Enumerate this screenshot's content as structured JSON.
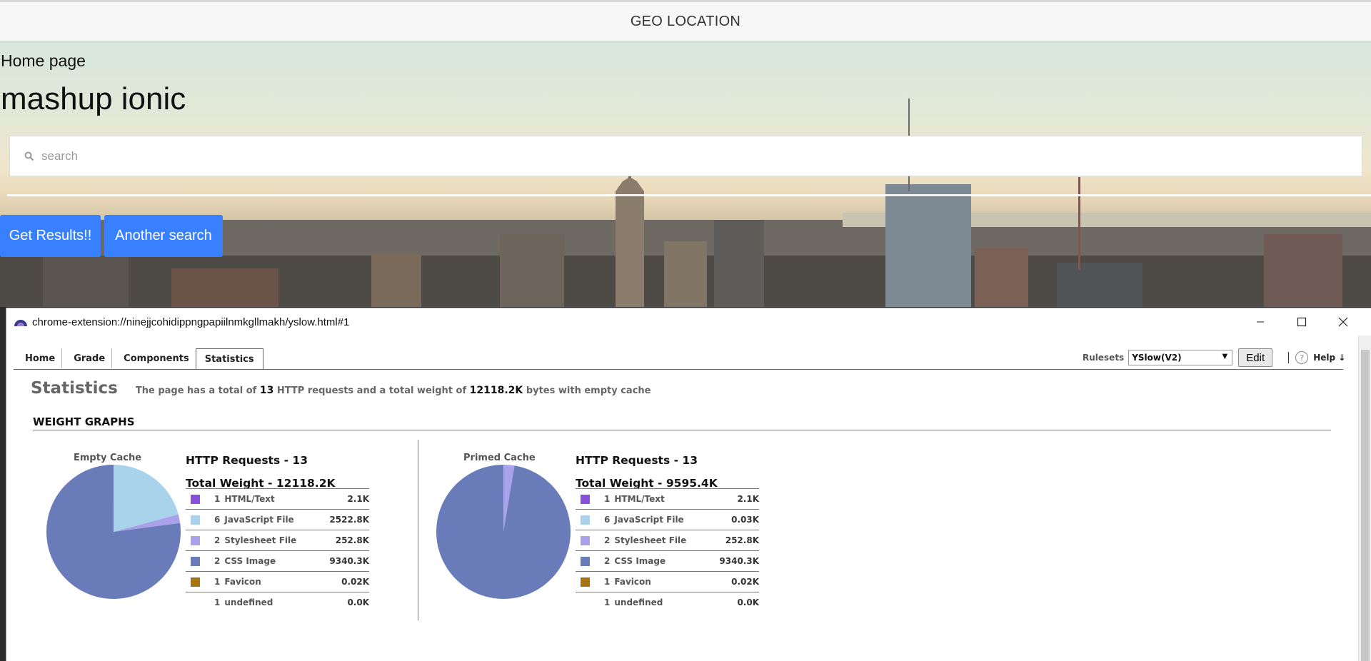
{
  "app": {
    "header_title": "GEO LOCATION",
    "home_label": "Home page",
    "title": "mashup ionic",
    "search": {
      "placeholder": "search",
      "value": ""
    },
    "buttons": {
      "get_results": "Get Results!!",
      "another_search": "Another search"
    },
    "accent_color": "#3880ff"
  },
  "window": {
    "url": "chrome-extension://ninejjcohidippngpapiilnmkgllmakh/yslow.html#1",
    "controls": {
      "minimize": "minimize-icon",
      "maximize": "maximize-icon",
      "close": "close-icon"
    }
  },
  "yslow": {
    "tabs": [
      {
        "label": "Home",
        "active": false
      },
      {
        "label": "Grade",
        "active": false
      },
      {
        "label": "Components",
        "active": false
      },
      {
        "label": "Statistics",
        "active": true
      }
    ],
    "rulesets_label": "Rulesets",
    "ruleset_selected": "YSlow(V2)",
    "edit_label": "Edit",
    "help_label": "Help ↓",
    "help_icon": "?",
    "stats_title": "Statistics",
    "stats_desc": {
      "p1": "The page has a total of",
      "requests": "13",
      "p2": "HTTP requests and a total weight of",
      "weight": "12118.2K",
      "p3": "bytes with empty cache"
    },
    "weight_graphs_title": "WEIGHT GRAPHS",
    "empty_cache": {
      "label": "Empty Cache",
      "requests_line": "HTTP Requests - 13",
      "weight_line": "Total Weight - 12118.2K",
      "rows": [
        {
          "count": "1",
          "type": "HTML/Text",
          "size": "2.1K",
          "color": "#8c4fdc"
        },
        {
          "count": "6",
          "type": "JavaScript File",
          "size": "2522.8K",
          "color": "#a8d3ea"
        },
        {
          "count": "2",
          "type": "Stylesheet File",
          "size": "252.8K",
          "color": "#a9a2ea"
        },
        {
          "count": "2",
          "type": "CSS Image",
          "size": "9340.3K",
          "color": "#6a7bba"
        },
        {
          "count": "1",
          "type": "Favicon",
          "size": "0.02K",
          "color": "#a87410"
        },
        {
          "count": "1",
          "type": "undefined",
          "size": "0.0K",
          "color": ""
        }
      ],
      "pie_kb": [
        2.1,
        2522.8,
        252.8,
        9340.3,
        0.02
      ]
    },
    "primed_cache": {
      "label": "Primed Cache",
      "requests_line": "HTTP Requests - 13",
      "weight_line": "Total Weight - 9595.4K",
      "rows": [
        {
          "count": "1",
          "type": "HTML/Text",
          "size": "2.1K",
          "color": "#8c4fdc"
        },
        {
          "count": "6",
          "type": "JavaScript File",
          "size": "0.03K",
          "color": "#a8d3ea"
        },
        {
          "count": "2",
          "type": "Stylesheet File",
          "size": "252.8K",
          "color": "#a9a2ea"
        },
        {
          "count": "2",
          "type": "CSS Image",
          "size": "9340.3K",
          "color": "#6a7bba"
        },
        {
          "count": "1",
          "type": "Favicon",
          "size": "0.02K",
          "color": "#a87410"
        },
        {
          "count": "1",
          "type": "undefined",
          "size": "0.0K",
          "color": ""
        }
      ],
      "pie_kb": [
        2.1,
        0.03,
        252.8,
        9340.3,
        0.02
      ]
    }
  }
}
